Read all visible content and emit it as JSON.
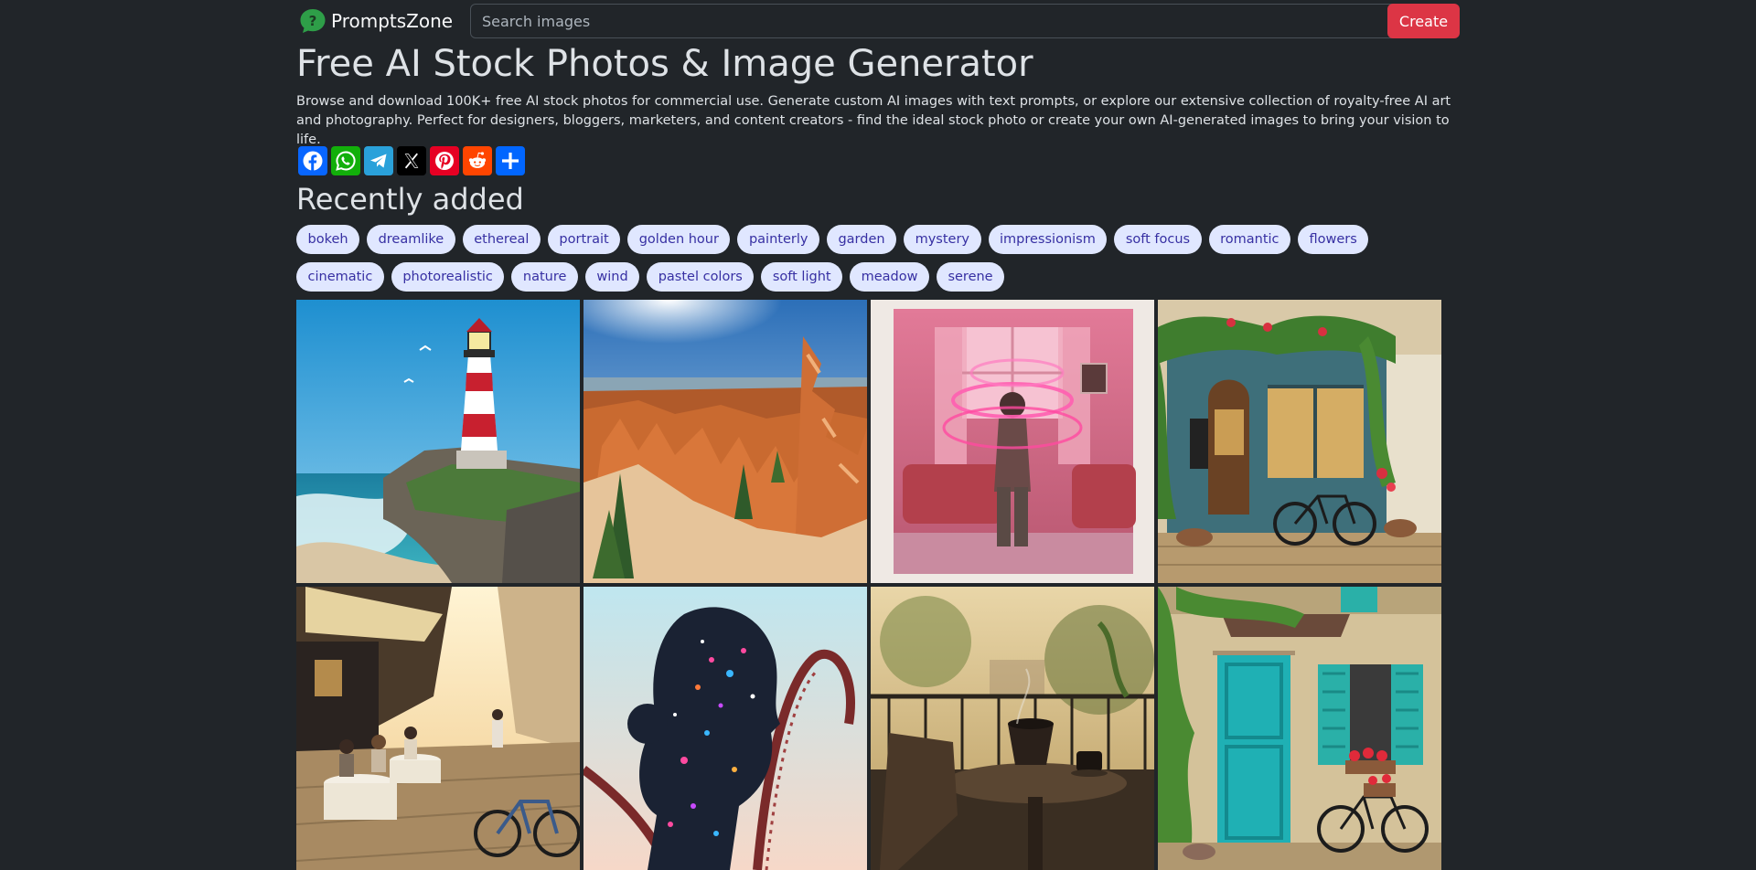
{
  "brand": {
    "name": "PromptsZone"
  },
  "search": {
    "placeholder": "Search images"
  },
  "header": {
    "create_label": "Create"
  },
  "page": {
    "title": "Free AI Stock Photos & Image Generator",
    "description": "Browse and download 100K+ free AI stock photos for commercial use. Generate custom AI images with text prompts, or explore our extensive collection of royalty-free AI art and photography. Perfect for designers, bloggers, marketers, and content creators - find the ideal stock photo or create your own AI-generated images to bring your vision to life."
  },
  "share": [
    {
      "name": "facebook",
      "color": "#0866ff"
    },
    {
      "name": "whatsapp",
      "color": "#12af0a"
    },
    {
      "name": "telegram",
      "color": "#2aa1da"
    },
    {
      "name": "x",
      "color": "#000000"
    },
    {
      "name": "pinterest",
      "color": "#e60023"
    },
    {
      "name": "reddit",
      "color": "#ff4500"
    },
    {
      "name": "share",
      "color": "#0166ff"
    }
  ],
  "section": {
    "title": "Recently added"
  },
  "tags": [
    "bokeh",
    "dreamlike",
    "ethereal",
    "portrait",
    "golden hour",
    "painterly",
    "garden",
    "mystery",
    "impressionism",
    "soft focus",
    "romantic",
    "flowers",
    "cinematic",
    "photorealistic",
    "nature",
    "wind",
    "pastel colors",
    "soft light",
    "meadow",
    "serene"
  ],
  "images": [
    "lighthouse-coast",
    "canyon-hoodoos",
    "pink-light-polaroid",
    "ivy-cafe-storefront",
    "street-cafe-bicycle",
    "cosmic-woman-rollercoaster",
    "balcony-coffee",
    "teal-door-bicycle"
  ]
}
